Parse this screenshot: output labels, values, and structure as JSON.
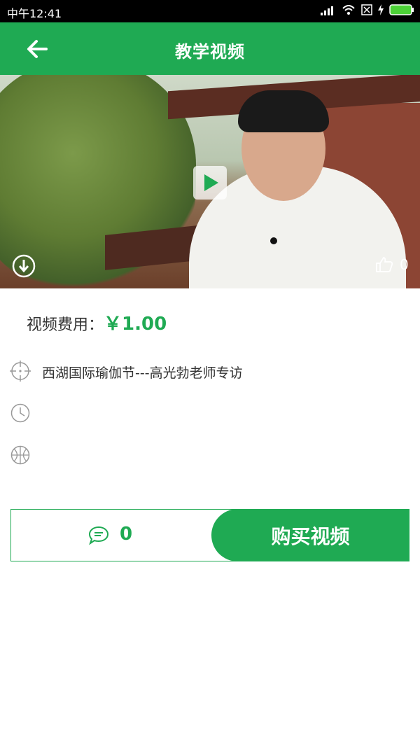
{
  "status": {
    "time": "中午12:41"
  },
  "header": {
    "title": "教学视频"
  },
  "video": {
    "likes": "0"
  },
  "price": {
    "label": "视频费用：",
    "value": "￥1.00"
  },
  "info": {
    "title": "西湖国际瑜伽节---高光勃老师专访",
    "time": "",
    "category": ""
  },
  "actions": {
    "comment_count": "0",
    "buy_label": "购买视频"
  },
  "colors": {
    "accent": "#1faa53"
  }
}
